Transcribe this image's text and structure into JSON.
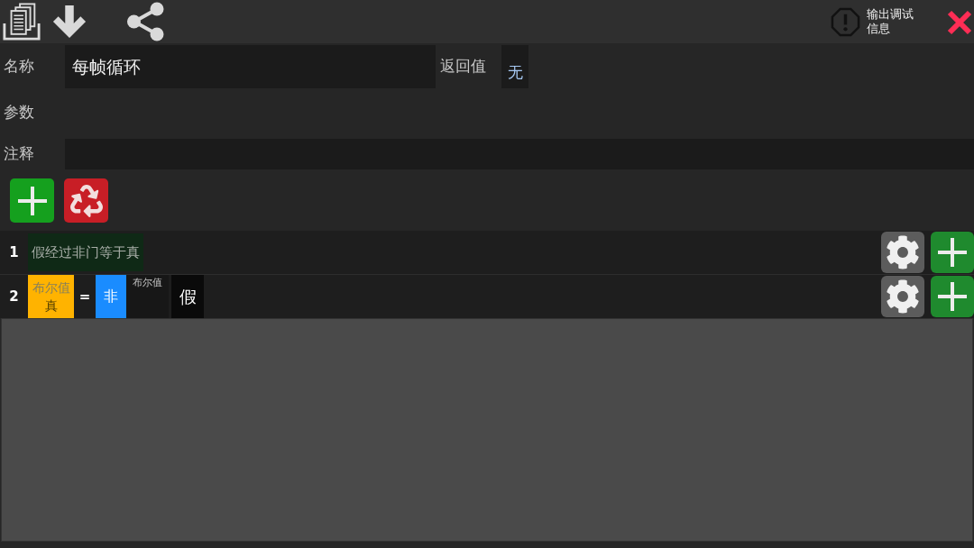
{
  "toolbar": {
    "debug_label": "输出调试信息"
  },
  "form": {
    "name_label": "名称",
    "name_value": "每帧循环",
    "return_label": "返回值",
    "return_value": "无",
    "params_label": "参数",
    "comment_label": "注释"
  },
  "code_lines": [
    {
      "number": "1",
      "blocks": [
        {
          "kind": "comment",
          "text": "假经过非门等于真"
        }
      ]
    },
    {
      "number": "2",
      "blocks": [
        {
          "kind": "variable",
          "type": "布尔值",
          "name": "真"
        },
        {
          "kind": "operator",
          "text": "="
        },
        {
          "kind": "function",
          "name": "非",
          "param_type": "布尔值",
          "param_value": "假"
        }
      ]
    }
  ]
}
